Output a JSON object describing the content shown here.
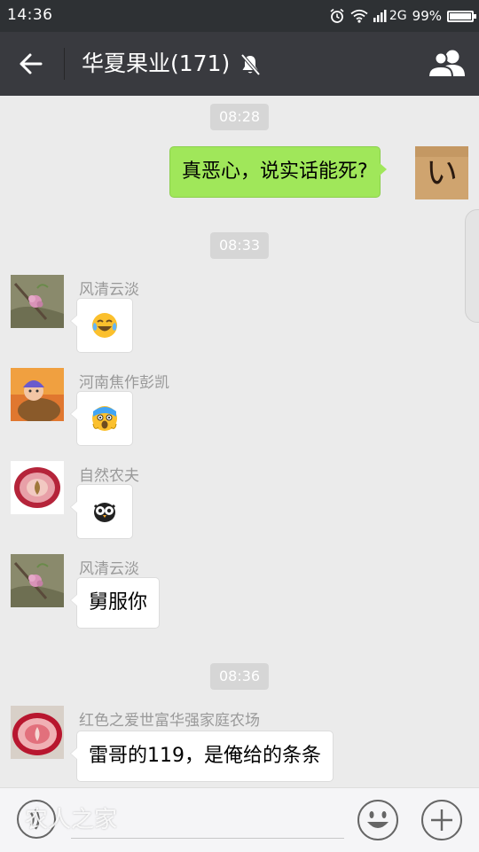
{
  "status_bar": {
    "time": "14:36",
    "network": "2G",
    "battery": "99%"
  },
  "header": {
    "title": "华夏果业(171)",
    "muted": true
  },
  "messages": [
    {
      "type": "timestamp",
      "text": "08:28"
    },
    {
      "type": "outgoing",
      "text": "真恶心，说实话能死?",
      "avatar_glyph": "い"
    },
    {
      "type": "timestamp",
      "text": "08:33"
    },
    {
      "type": "incoming",
      "sender": "风清云淡",
      "content": "emoji",
      "emoji": "crying-laughing-face"
    },
    {
      "type": "incoming",
      "sender": "河南焦作彭凯",
      "content": "emoji",
      "emoji": "screaming-face"
    },
    {
      "type": "incoming",
      "sender": "自然农夫",
      "content": "emoji",
      "emoji": "owl"
    },
    {
      "type": "incoming",
      "sender": "风清云淡",
      "text": "舅服你"
    },
    {
      "type": "timestamp",
      "text": "08:36"
    },
    {
      "type": "incoming",
      "sender": "红色之爱世富华强家庭农场",
      "text": "雷哥的119，是俺给的条条"
    }
  ],
  "input_bar": {
    "watermark": "农人之家"
  },
  "colors": {
    "status_bar": "#2e3134",
    "title_bar": "#393a3f",
    "chat_background": "#ebebeb",
    "outgoing_bubble": "#a0e75a",
    "incoming_bubble": "#ffffff",
    "timestamp_bg": "#d6d6d6"
  }
}
